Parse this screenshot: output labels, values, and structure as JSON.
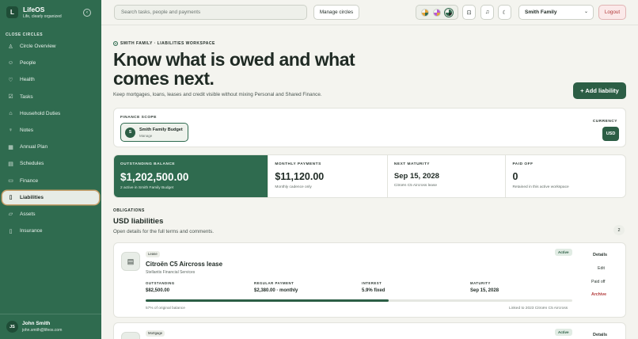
{
  "app": {
    "name": "LifeOS",
    "tagline": "Life, clearly organized",
    "logo_letter": "L"
  },
  "sidebar": {
    "section": "CLOSE CIRCLES",
    "items": [
      {
        "label": "Circle Overview",
        "icon": "person-icon"
      },
      {
        "label": "People",
        "icon": "people-icon"
      },
      {
        "label": "Health",
        "icon": "heart-icon"
      },
      {
        "label": "Tasks",
        "icon": "check-icon"
      },
      {
        "label": "Household Duties",
        "icon": "home-icon"
      },
      {
        "label": "Notes",
        "icon": "bulb-icon"
      },
      {
        "label": "Annual Plan",
        "icon": "calendar-icon"
      },
      {
        "label": "Schedules",
        "icon": "calendar-icon"
      },
      {
        "label": "Finance",
        "icon": "card-icon"
      },
      {
        "label": "Liabilities",
        "icon": "doc-icon",
        "active": true
      },
      {
        "label": "Assets",
        "icon": "folder-icon"
      },
      {
        "label": "Insurance",
        "icon": "doc-icon"
      }
    ],
    "user": {
      "initials": "JS",
      "name": "John Smith",
      "email": "john.smith@lifeos.com"
    }
  },
  "topbar": {
    "search_placeholder": "Search tasks, people and payments",
    "manage_circles": "Manage circles",
    "circle_select": "Smith Family",
    "logout": "Logout",
    "theme_colors": [
      "#e4a53a",
      "#b85ad6",
      "#2f6b4f"
    ]
  },
  "header": {
    "eyebrow": "SMITH FAMILY · LIABILITIES WORKSPACE",
    "title": "Know what is owed and what comes next.",
    "subtitle": "Keep mortgages, loans, leases and credit visible without mixing Personal and Shared Finance.",
    "add_button": "+ Add liability"
  },
  "scope": {
    "label": "FINANCE SCOPE",
    "chip_letter": "S",
    "chip_name": "Smith Family Budget",
    "chip_sub": "Manage",
    "currency_label": "CURRENCY",
    "currency": "USD"
  },
  "stats": [
    {
      "label": "OUTSTANDING BALANCE",
      "value": "$1,202,500.00",
      "sub": "2 active in Smith Family Budget"
    },
    {
      "label": "MONTHLY PAYMENTS",
      "value": "$11,120.00",
      "sub": "Monthly cadence only"
    },
    {
      "label": "NEXT MATURITY",
      "value": "Sep 15, 2028",
      "sub": "Citroën C5 Aircross lease"
    },
    {
      "label": "PAID OFF",
      "value": "0",
      "sub": "Retained in this active workspace"
    }
  ],
  "obligations": {
    "label": "OBLIGATIONS",
    "title": "USD liabilities",
    "subtitle": "Open details for the full terms and comments.",
    "count": "2"
  },
  "liabilities": [
    {
      "tag": "Lease",
      "status": "Active",
      "title": "Citroën C5 Aircross lease",
      "lender": "Stellantis Financial Services",
      "fields": [
        {
          "label": "OUTSTANDING",
          "value": "$82,500.00"
        },
        {
          "label": "REGULAR PAYMENT",
          "value": "$2,380.00 · monthly"
        },
        {
          "label": "INTEREST",
          "value": "5.9% fixed"
        },
        {
          "label": "MATURITY",
          "value": "Sep 15, 2028"
        }
      ],
      "progress_pct": 57,
      "progress_text": "57% of original balance",
      "linked": "Linked to 2023 Citroën C5 Aircross",
      "actions": {
        "details": "Details",
        "edit": "Edit",
        "paid_off": "Paid off",
        "archive": "Archive"
      }
    },
    {
      "tag": "Mortgage",
      "status": "Active",
      "actions": {
        "details": "Details"
      }
    }
  ]
}
